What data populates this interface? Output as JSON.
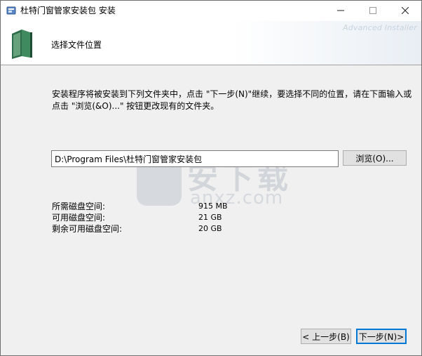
{
  "window": {
    "title": "杜特门窗管家安装包 安装",
    "controls": {
      "minimize": "—",
      "maximize": "☐",
      "close": "✕"
    }
  },
  "header": {
    "title": "选择文件位置",
    "brand": "Advanced Installer"
  },
  "main": {
    "description_line1": "安装程序将被安装到下列文件夹中，点击 \"下一步(N)\"继续，要选择不同的位置，请在下面输入或",
    "description_line2": "点击 \"浏览(&O)...\" 按钮更改现有的文件夹。",
    "install_path": "D:\\Program Files\\杜特门窗管家安装包",
    "browse_label": "浏览(O)..."
  },
  "space": {
    "rows": [
      {
        "label": "所需磁盘空间:",
        "value": "915 MB"
      },
      {
        "label": "可用磁盘空间:",
        "value": "21 GB"
      },
      {
        "label": "剩余可用磁盘空间:",
        "value": "20 GB"
      }
    ]
  },
  "footer": {
    "back_label": "< 上一步(B)",
    "next_label": "下一步(N)>"
  },
  "watermark": {
    "cn": "安下载",
    "en": "anxz.com"
  },
  "colors": {
    "accent": "#0078d7",
    "header_bg": "#ffffff",
    "body_bg": "#f0f0f0"
  }
}
